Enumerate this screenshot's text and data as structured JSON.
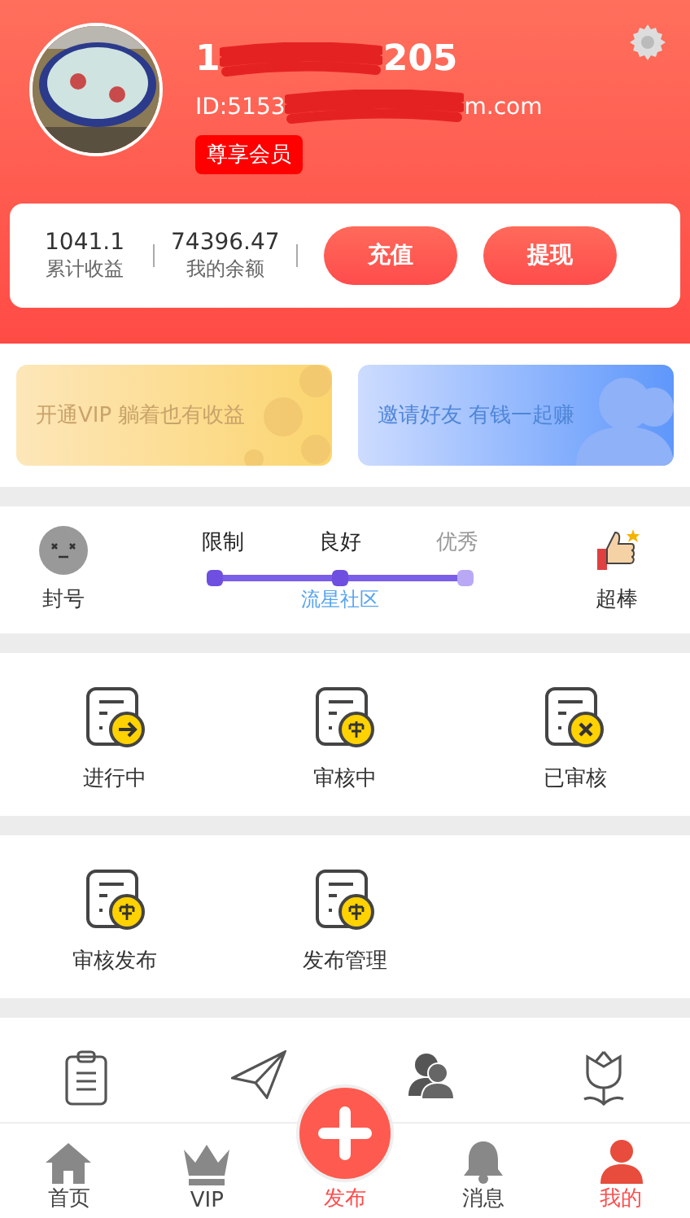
{
  "profile": {
    "phone_start": "1",
    "phone_end": "205",
    "id_start": "ID:5153",
    "id_end": "m.com",
    "badge": "尊享会员"
  },
  "stats": [
    {
      "value": "1041.1",
      "label": "累计收益"
    },
    {
      "value": "74396.47",
      "label": "我的余额"
    }
  ],
  "actions": [
    "充值",
    "提现"
  ],
  "banners": [
    {
      "kind": "vip",
      "text": "开通VIP 躺着也有收益"
    },
    {
      "kind": "invite",
      "text": "邀请好友 有钱一起赚"
    }
  ],
  "credit": {
    "left": "封号",
    "right": "超棒",
    "caption": "流星社区",
    "steps": [
      {
        "label": "限制",
        "reached": true
      },
      {
        "label": "良好",
        "reached": true
      },
      {
        "label": "优秀",
        "reached": false
      }
    ]
  },
  "grid_1": [
    {
      "label": "进行中",
      "kind": "arrow"
    },
    {
      "label": "审核中",
      "kind": "review"
    },
    {
      "label": "已审核",
      "kind": "cross"
    }
  ],
  "grid_2": [
    {
      "label": "审核发布",
      "kind": "review"
    },
    {
      "label": "发布管理",
      "kind": "review"
    }
  ],
  "grid_3": [
    {
      "kind": "clipboard"
    },
    {
      "kind": "plane"
    },
    {
      "kind": "people"
    },
    {
      "kind": "tulip"
    }
  ],
  "tabs": [
    {
      "label": "首页",
      "kind": "home",
      "selected": false
    },
    {
      "label": "VIP",
      "kind": "crown",
      "selected": false
    },
    {
      "label": "发布",
      "kind": "publish",
      "selected": false
    },
    {
      "label": "消息",
      "kind": "bell",
      "selected": false
    },
    {
      "label": "我的",
      "kind": "user",
      "selected": true
    }
  ]
}
